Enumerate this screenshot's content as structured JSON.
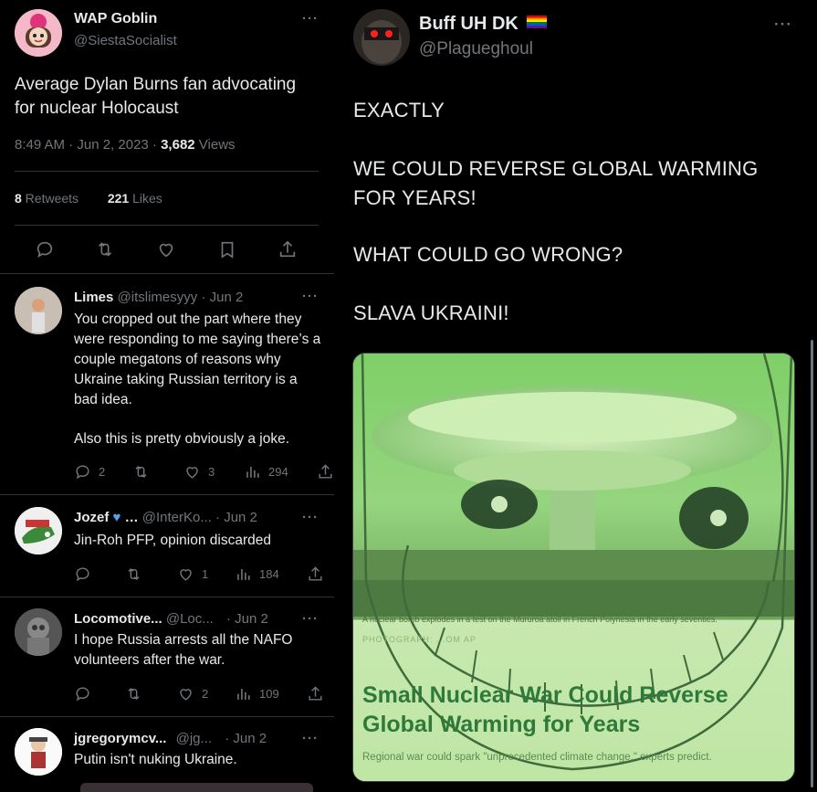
{
  "main_tweet": {
    "display_name": "WAP Goblin",
    "handle": "@SiestaSocialist",
    "more_label": "···",
    "text_line1": "Average Dylan Burns fan advocating",
    "text_line2": "for nuclear Holocaust",
    "time": "8:49 AM · Jun 2, 2023 · ",
    "views_count": "3,682",
    "views_label": " Views",
    "retweets_count": "8",
    "retweets_label": " Retweets",
    "likes_count": "221",
    "likes_label": " Likes"
  },
  "replies": [
    {
      "name": "Limes",
      "handle": "@itslimesyyy",
      "date": "· Jun 2",
      "more": "···",
      "text": "You cropped out the part where they were responding to me saying there’s a couple megatons of reasons why Ukraine taking Russian territory is a bad idea.",
      "text2": "Also this is pretty obviously a joke.",
      "reply_count": "2",
      "retweet_count": "",
      "like_count": "3",
      "view_count": "294"
    },
    {
      "name": "Jozef",
      "name_suffix": "…",
      "handle": "@InterKo...",
      "date": "· Jun 2",
      "more": "···",
      "text": "Jin-Roh PFP, opinion discarded",
      "reply_count": "",
      "retweet_count": "",
      "like_count": "1",
      "view_count": "184"
    },
    {
      "name": "Locomotive...",
      "handle": "@Loc...",
      "date": "· Jun 2",
      "more": "···",
      "text": "I hope Russia arrests all the NAFO volunteers after the war.",
      "reply_count": "",
      "retweet_count": "",
      "like_count": "2",
      "view_count": "109"
    },
    {
      "name": "jgregorymcv...",
      "handle": "@jg...",
      "date": "· Jun 2",
      "more": "···",
      "text": "Putin isn't nuking Ukraine."
    }
  ],
  "quoted_tweet": {
    "display_name": "Buff UH DK",
    "handle": "@Plagueghoul",
    "more": "···",
    "line1": "EXACTLY",
    "line2": "WE COULD REVERSE GLOBAL WARMING",
    "line3": "FOR YEARS!",
    "line4": "WHAT COULD GO WRONG?",
    "line5": "SLAVA UKRAINI!"
  },
  "card": {
    "caption": "A nuclear bomb explodes in a test on the Mururoa atoll in French Polynesia in the early seventies.",
    "credit": "PHOTOGRAPH: ...OM AP",
    "headline_line1": "Small Nuclear War Could Reverse",
    "headline_line2": "Global Warming for Years",
    "subhead": "Regional war could spark \"unprecedented climate change,\" experts predict."
  },
  "colors": {
    "background": "#000000",
    "text_primary": "#e7e9ea",
    "text_secondary": "#71767b",
    "divider": "#2f3336",
    "card_tint": "#b9e59a",
    "headline_green": "#2e7a3a"
  }
}
